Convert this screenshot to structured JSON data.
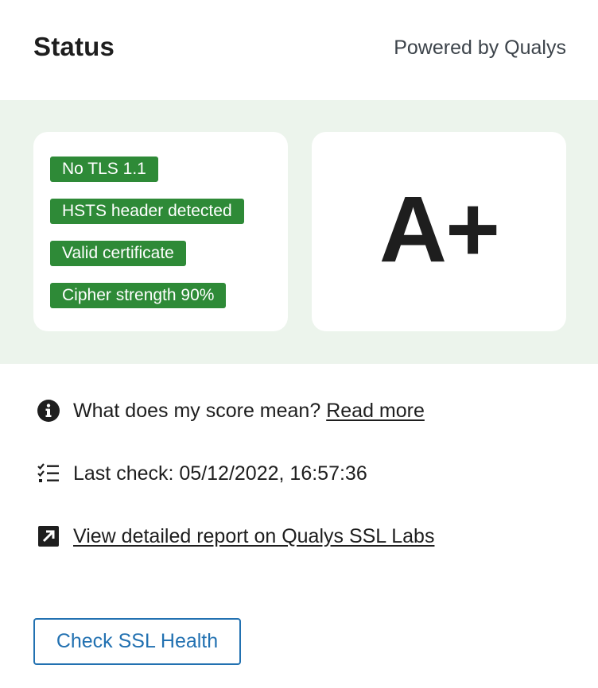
{
  "header": {
    "title": "Status",
    "powered_by": "Powered by Qualys"
  },
  "badges": [
    {
      "label": "No TLS 1.1"
    },
    {
      "label": "HSTS header detected"
    },
    {
      "label": "Valid certificate"
    },
    {
      "label": "Cipher strength 90%"
    }
  ],
  "grade": "A+",
  "info": {
    "score_question": "What does my score mean?",
    "read_more": "Read more",
    "last_check": "Last check: 05/12/2022, 16:57:36",
    "report_link": "View detailed report on Qualys SSL Labs"
  },
  "actions": {
    "check_button": "Check SSL Health"
  },
  "colors": {
    "badge_green": "#2e8a37",
    "panel_bg": "#ecf4ec",
    "button_blue": "#2271b1"
  },
  "icons": [
    "info-icon",
    "checklist-icon",
    "external-link-icon"
  ]
}
